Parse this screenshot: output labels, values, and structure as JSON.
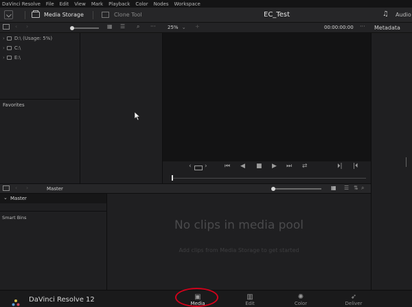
{
  "menubar": {
    "items": [
      "DaVinci Resolve",
      "File",
      "Edit",
      "View",
      "Mark",
      "Playback",
      "Color",
      "Nodes",
      "Workspace"
    ]
  },
  "topbar": {
    "media_storage": "Media Storage",
    "clone_tool": "Clone Tool",
    "project_title": "EC_Test",
    "audio": "Audio"
  },
  "subbar": {
    "zoom": "25%",
    "timecode": "00:00:00:00",
    "metadata": "Metadata",
    "more": "···"
  },
  "storage": {
    "drives": [
      {
        "label": "D:\\ (Usage: 5%)"
      },
      {
        "label": "C:\\"
      },
      {
        "label": "E:\\"
      }
    ],
    "favorites": "Favorites"
  },
  "pool": {
    "title": "Master",
    "bin_master": "Master",
    "smart_bins": "Smart Bins",
    "empty_title": "No clips in media pool",
    "empty_sub": "Add clips from Media Storage to get started"
  },
  "bottombar": {
    "brand": "DaVinci Resolve 12",
    "pages": [
      {
        "label": "Media",
        "icon": "media-icon"
      },
      {
        "label": "Edit",
        "icon": "edit-icon"
      },
      {
        "label": "Color",
        "icon": "color-icon"
      },
      {
        "label": "Deliver",
        "icon": "deliver-icon"
      }
    ]
  },
  "colors": {
    "accent_circle": "#d0021b",
    "background": "#1c1c1e"
  }
}
